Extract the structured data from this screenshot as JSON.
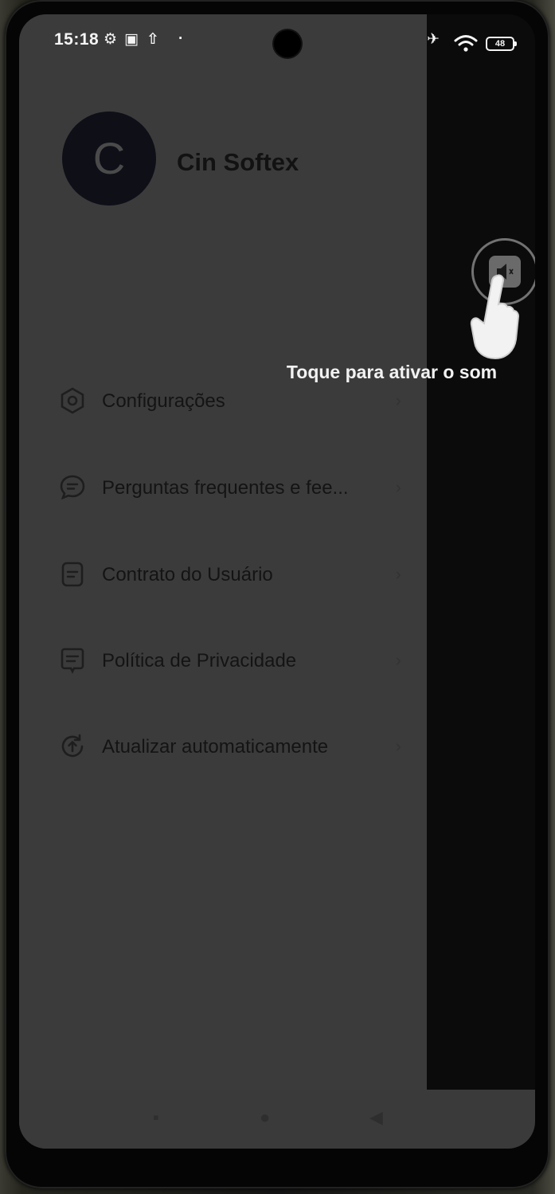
{
  "status_bar": {
    "time": "15:18",
    "battery": "48"
  },
  "profile": {
    "avatar_initial": "C",
    "name": "Cin Softex"
  },
  "menu": {
    "items": [
      {
        "label": "Configurações",
        "icon": "settings-hexagon-icon"
      },
      {
        "label": "Perguntas frequentes e fee...",
        "icon": "chat-bubble-icon"
      },
      {
        "label": "Contrato do Usuário",
        "icon": "document-icon"
      },
      {
        "label": "Política de Privacidade",
        "icon": "privacy-document-icon"
      },
      {
        "label": "Atualizar automaticamente",
        "icon": "auto-update-icon"
      }
    ]
  },
  "overlay": {
    "hint_text": "Toque para ativar o som",
    "icon": "speaker-muted-icon"
  },
  "colors": {
    "drawer_bg": "#3b3b3b",
    "screen_dim": "#0b0b0b",
    "text_dark": "#141414",
    "hint_text": "#f2f2f2"
  }
}
